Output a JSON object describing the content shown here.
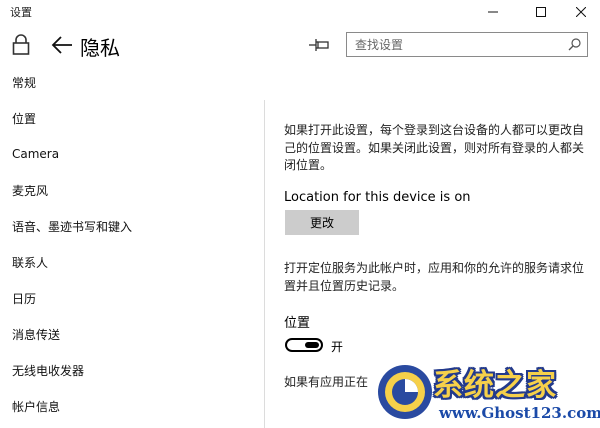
{
  "window": {
    "title": "设置",
    "controls": {
      "minimize_icon": "minimize-icon",
      "maximize_icon": "maximize-icon",
      "close_icon": "close-icon"
    }
  },
  "header": {
    "title": "隐私",
    "icons": [
      "lock-icon",
      "back-arrow-icon",
      "pin-icon"
    ]
  },
  "search": {
    "placeholder": "查找设置",
    "value": "",
    "icon": "search-icon"
  },
  "sidebar": {
    "items": [
      {
        "label": "常规"
      },
      {
        "label": "位置"
      },
      {
        "label": "Camera"
      },
      {
        "label": "麦克风"
      },
      {
        "label": "语音、墨迹书写和键入"
      },
      {
        "label": "联系人"
      },
      {
        "label": "日历"
      },
      {
        "label": "消息传送"
      },
      {
        "label": "无线电收发器"
      },
      {
        "label": "帐户信息"
      }
    ]
  },
  "main": {
    "description_1": "如果打开此设置，每个登录到这台设备的人都可以更改自己的位置设置。如果关闭此设置，则对所有登录的人都关闭位置。",
    "device_status": "Location for this device is on",
    "change_button": "更改",
    "description_2": "打开定位服务为此帐户时，应用和你的允许的服务请求位置并且位置历史记录。",
    "location_label": "位置",
    "toggle": {
      "state_label": "开",
      "on": true
    },
    "description_3": "如果有应用正在"
  },
  "watermark": {
    "title": "系统之家",
    "url": "www.Ghost123.com",
    "colors": {
      "title": "#f6d04a",
      "outline": "#233a8c",
      "url": "#1b4aa8"
    }
  }
}
